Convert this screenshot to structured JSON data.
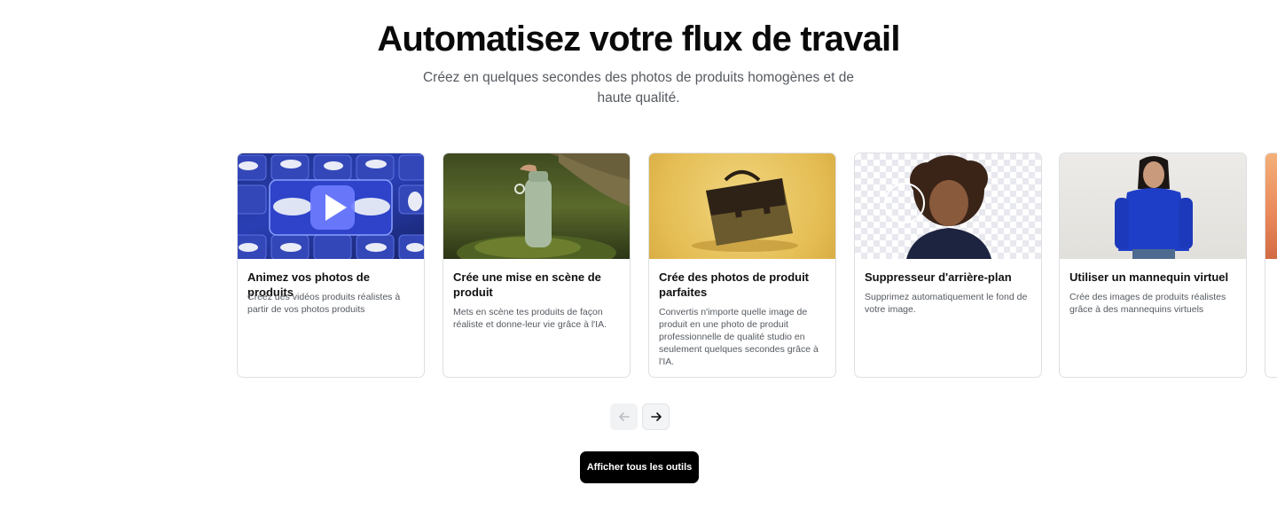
{
  "header": {
    "title": "Automatisez votre flux de travail",
    "subtitle": "Créez en quelques secondes des photos de produits homogènes et de haute qualité."
  },
  "cards": [
    {
      "title": "Animez vos photos de produits",
      "description": "Créez des vidéos produits réalistes à partir de vos photos produits",
      "image": "sneakers-grid-with-play-icon"
    },
    {
      "title": "Crée une mise en scène de produit",
      "description": "Mets en scène tes produits de façon réaliste et donne-leur vie grâce à l'IA.",
      "image": "water-bottle-on-moss"
    },
    {
      "title": "Crée des photos de produit parfaites",
      "description": "Convertis n'importe quelle image de produit en une photo de produit professionnelle de qualité studio en seulement quelques secondes grâce à l'IA.",
      "image": "brown-satchel-on-yellow"
    },
    {
      "title": "Suppresseur d'arrière-plan",
      "description": "Supprimez automatiquement le fond de votre image.",
      "image": "portrait-transparent-background"
    },
    {
      "title": "Utiliser un mannequin virtuel",
      "description": "Crée des images de produits réalistes grâce à des mannequins virtuels",
      "image": "model-blue-sweater"
    }
  ],
  "carousel_nav": {
    "prev_icon": "arrow-left-icon",
    "next_icon": "arrow-right-icon",
    "prev_disabled": true
  },
  "cta": {
    "label": "Afficher tous les outils"
  },
  "colors": {
    "accent": "#000000",
    "text_muted": "#555a60",
    "card_border": "#dedfe2"
  }
}
